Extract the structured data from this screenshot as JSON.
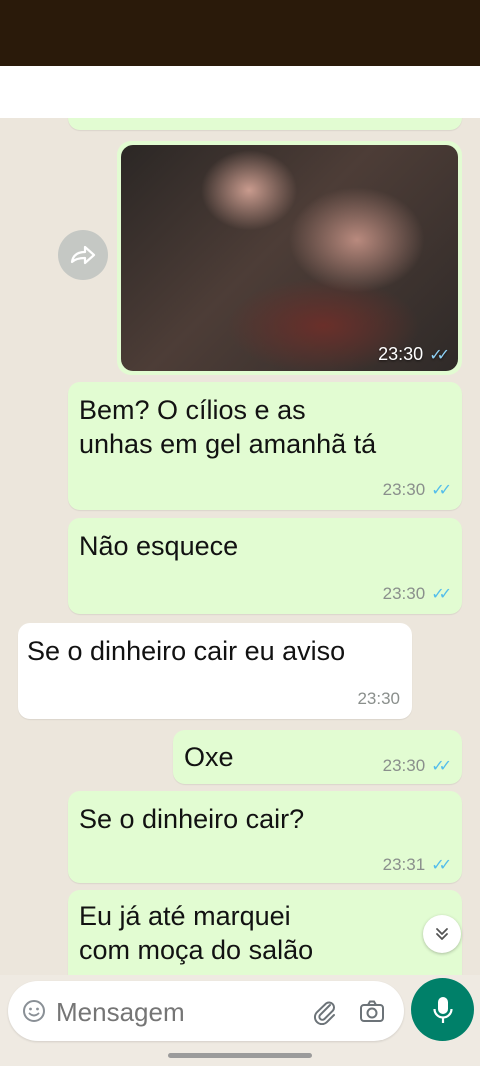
{
  "messages": [
    {
      "id": "img1",
      "type": "image",
      "time": "23:30"
    },
    {
      "id": "m1",
      "text": "Bem? O cílios e as\nunhas em gel amanhã tá",
      "time": "23:30"
    },
    {
      "id": "m2",
      "text": "Não esquece",
      "time": "23:30"
    },
    {
      "id": "m3",
      "text": "Se o dinheiro cair eu aviso",
      "time": "23:30"
    },
    {
      "id": "m4",
      "text": "Oxe",
      "time": "23:30"
    },
    {
      "id": "m5",
      "text": "Se o dinheiro cair?",
      "time": "23:31"
    },
    {
      "id": "m6",
      "text": "Eu já até marquei\ncom moça do salão",
      "time": ""
    }
  ],
  "composer": {
    "placeholder": "Mensagem"
  },
  "icons": {
    "forward": "forward-icon",
    "emoji": "emoji-icon",
    "attach": "paperclip-icon",
    "camera": "camera-icon",
    "mic": "mic-icon",
    "scroll": "chevron-double-down-icon",
    "read_receipt": "double-check-icon"
  },
  "colors": {
    "accent": "#008069",
    "outgoing": "#e2fcd2",
    "incoming": "#ffffff",
    "read": "#53bdeb"
  }
}
